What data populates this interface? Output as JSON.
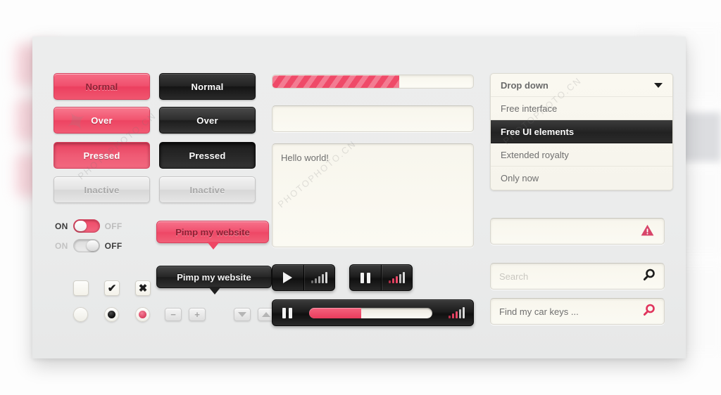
{
  "buttons": {
    "pink": [
      {
        "label": "Normal",
        "state": "normal"
      },
      {
        "label": "Over",
        "state": "over"
      },
      {
        "label": "Pressed",
        "state": "pressed"
      },
      {
        "label": "Inactive",
        "state": "inactive"
      }
    ],
    "dark": [
      {
        "label": "Normal",
        "state": "normal"
      },
      {
        "label": "Over",
        "state": "over"
      },
      {
        "label": "Pressed",
        "state": "pressed"
      },
      {
        "label": "Inactive",
        "state": "inactive"
      }
    ]
  },
  "toggles": [
    {
      "on_label": "ON",
      "off_label": "OFF",
      "state": "on"
    },
    {
      "on_label": "ON",
      "off_label": "OFF",
      "state": "off"
    }
  ],
  "checkboxes": [
    {
      "mark": "",
      "name": "empty"
    },
    {
      "mark": "✔",
      "name": "checked"
    },
    {
      "mark": "✖",
      "name": "crossed"
    }
  ],
  "radios": [
    {
      "state": "empty"
    },
    {
      "state": "black"
    },
    {
      "state": "pink"
    }
  ],
  "tooltips": [
    {
      "label": "Pimp my website",
      "style": "pink"
    },
    {
      "label": "Pimp my website",
      "style": "dark"
    }
  ],
  "steppers": [
    {
      "label": "−",
      "name": "minus"
    },
    {
      "label": "+",
      "name": "plus"
    }
  ],
  "spinners": [
    {
      "name": "down"
    },
    {
      "name": "up"
    }
  ],
  "progress": {
    "value": 63,
    "max": 100
  },
  "fields": {
    "text_input_value": "",
    "text_input_placeholder": "",
    "textarea_value": "Hello world!",
    "error_value": "",
    "error_placeholder": "",
    "search_placeholder": "Search",
    "find_value": "Find my car keys ..."
  },
  "dropdown": {
    "header": "Drop down",
    "items": [
      {
        "label": "Free interface",
        "selected": false
      },
      {
        "label": "Free UI elements",
        "selected": true
      },
      {
        "label": "Extended royalty",
        "selected": false
      },
      {
        "label": "Only now",
        "selected": false
      }
    ]
  },
  "players": {
    "small": [
      {
        "icon": "play",
        "equalizer": "grey"
      },
      {
        "icon": "pause",
        "equalizer": "pink"
      }
    ],
    "wide": {
      "icon": "pause",
      "equalizer": "pink",
      "progress": 42
    }
  },
  "icons": {
    "caret": "chevron-down-icon",
    "warning": "warning-triangle-icon",
    "search_grey": "magnifier-icon",
    "search_pink": "magnifier-icon"
  },
  "colors": {
    "accent_pink": "#ef4a68",
    "dark": "#1d1d1d",
    "panel_bg": "#ebecec",
    "field_bg": "#faf8f0"
  },
  "watermark": "PHOTOPHOTO.CN"
}
